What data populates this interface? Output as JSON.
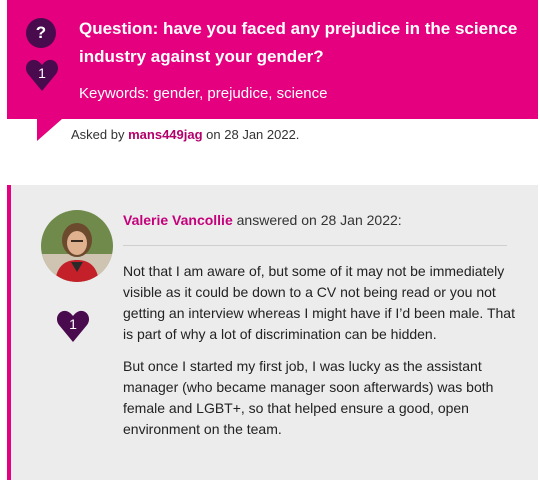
{
  "question": {
    "badge_symbol": "?",
    "likes": "1",
    "title": "Question: have you faced any prejudice in the science industry against your gender?",
    "keywords": "Keywords: gender, prejudice, science",
    "asked_prefix": "Asked by",
    "asker": "mans449jag",
    "asked_date": "on 28 Jan 2022."
  },
  "answer": {
    "author": "Valerie Vancollie",
    "answered_suffix": "answered on 28 Jan 2022:",
    "likes": "1",
    "paragraphs": [
      "Not that I am aware of, but some of it may not be immediately visible as it could be down to a CV not being read or you not getting an interview whereas I might have if I’d been male. That is part of why a lot of discrimination can be hidden.",
      "But once I started my first job, I was lucky as the assistant manager (who became manager soon afterwards) was both female and LGBT+, so that helped ensure a good, open environment on the team."
    ]
  },
  "colors": {
    "accent": "#e4007e",
    "badge": "#4a0a4e",
    "answer_bg": "#ececec"
  },
  "icons": {
    "question": "question-mark-icon",
    "like": "heart-icon"
  }
}
